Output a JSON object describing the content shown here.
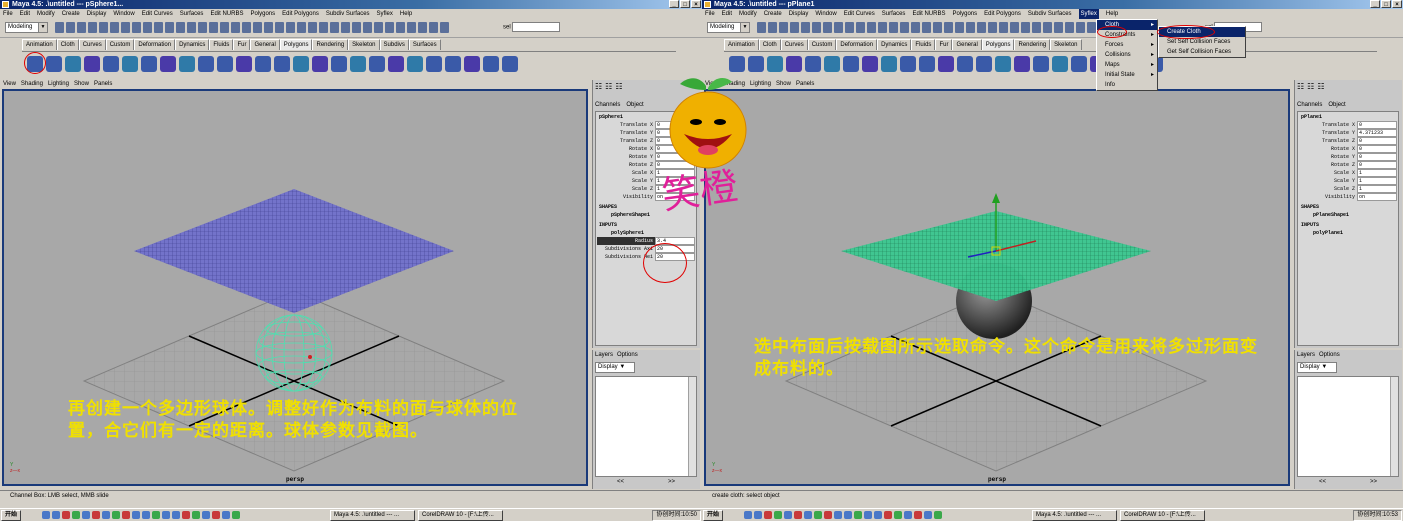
{
  "left": {
    "window_title": "Maya 4.5: .\\untitled  ---  pSphere1...",
    "menus": [
      "File",
      "Edit",
      "Modify",
      "Create",
      "Display",
      "Window",
      "Edit Curves",
      "Surfaces",
      "Edit NURBS",
      "Polygons",
      "Edit Polygons",
      "Subdiv Surfaces",
      "Syflex",
      "Help"
    ],
    "mode": "Modeling",
    "sel_label": "sel",
    "shelf_tabs": [
      "Animation",
      "Cloth",
      "Curves",
      "Custom",
      "Deformation",
      "Dynamics",
      "Fluids",
      "Fur",
      "General",
      "Polygons",
      "Rendering",
      "Skeleton",
      "Subdivs",
      "Surfaces"
    ],
    "active_tab": "Polygons",
    "viewport_menu": [
      "View",
      "Shading",
      "Lighting",
      "Show",
      "Panels"
    ],
    "camera": "persp",
    "channel_tabs": [
      "Channels",
      "Object"
    ],
    "object_name": "pSphere1",
    "channels": [
      {
        "label": "Translate X",
        "value": "0"
      },
      {
        "label": "Translate Y",
        "value": "0"
      },
      {
        "label": "Translate Z",
        "value": "0"
      },
      {
        "label": "Rotate X",
        "value": "0"
      },
      {
        "label": "Rotate Y",
        "value": "0"
      },
      {
        "label": "Rotate Z",
        "value": "0"
      },
      {
        "label": "Scale X",
        "value": "1"
      },
      {
        "label": "Scale Y",
        "value": "1"
      },
      {
        "label": "Scale Z",
        "value": "1"
      },
      {
        "label": "Visibility",
        "value": "on"
      }
    ],
    "shapes_label": "SHAPES",
    "shape_name": "pSphereShape1",
    "inputs_label": "INPUTS",
    "input_name": "polySphere1",
    "input_channels": [
      {
        "label": "Radius",
        "value": "3.4"
      },
      {
        "label": "Subdivisions Axi",
        "value": "20"
      },
      {
        "label": "Subdivisions Hei",
        "value": "20"
      }
    ],
    "layers_tabs": [
      "Layers",
      "Options"
    ],
    "layers_display": "Display",
    "help_line": "Channel Box: LMB select, MMB slide",
    "note": "再创建一个多边形球体。调整好作为布料的面与球体的位置，合它们有一定的距离。球体参数见截图。"
  },
  "right": {
    "window_title": "Maya 4.5: .\\untitled  ---  pPlane1",
    "menus": [
      "File",
      "Edit",
      "Modify",
      "Create",
      "Display",
      "Window",
      "Edit Curves",
      "Surfaces",
      "Edit NURBS",
      "Polygons",
      "Edit Polygons",
      "Subdiv Surfaces",
      "Syflex",
      "Help"
    ],
    "mode": "Modeling",
    "sel_label": "sel",
    "shelf_tabs": [
      "Animation",
      "Cloth",
      "Curves",
      "Custom",
      "Deformation",
      "Dynamics",
      "Fluids",
      "Fur",
      "General",
      "Polygons",
      "Rendering",
      "Skeleton"
    ],
    "active_tab": "Polygons",
    "viewport_menu": [
      "View",
      "Shading",
      "Lighting",
      "Show",
      "Panels"
    ],
    "camera": "persp",
    "channel_tabs": [
      "Channels",
      "Object"
    ],
    "object_name": "pPlane1",
    "channels": [
      {
        "label": "Translate X",
        "value": "0"
      },
      {
        "label": "Translate Y",
        "value": "4.371233"
      },
      {
        "label": "Translate Z",
        "value": "0"
      },
      {
        "label": "Rotate X",
        "value": "0"
      },
      {
        "label": "Rotate Y",
        "value": "0"
      },
      {
        "label": "Rotate Z",
        "value": "0"
      },
      {
        "label": "Scale X",
        "value": "1"
      },
      {
        "label": "Scale Y",
        "value": "1"
      },
      {
        "label": "Scale Z",
        "value": "1"
      },
      {
        "label": "Visibility",
        "value": "on"
      }
    ],
    "shapes_label": "SHAPES",
    "shape_name": "pPlaneShape1",
    "inputs_label": "INPUTS",
    "input_name": "polyPlane1",
    "layers_tabs": [
      "Layers",
      "Options"
    ],
    "layers_display": "Display",
    "help_line": "create cloth: select object",
    "syflex_menu": [
      "Cloth",
      "Constraints",
      "Forces",
      "Collisions",
      "Maps",
      "Initial State",
      "Info"
    ],
    "cloth_submenu": [
      "Create Cloth",
      "Set Self Collision Faces",
      "Get Self Collision Faces"
    ],
    "note": "选中布面后按载图所示选取命令。这个命令是用来将多过形面变成布料的。"
  },
  "taskbar": {
    "start_label": "开始",
    "task_maya": "Maya 4.5: .\\untitled  --- ...",
    "task_corel": "CorelDRAW 10 - [F:\\上传...",
    "clock_left": "协创时间:10:50",
    "clock_right": "协创时间:10:53"
  },
  "watermark": {
    "text": "笑橙"
  },
  "colors": {
    "mesh_blue": "#3a3a9a",
    "cloth_green": "#3ac890",
    "note_yellow": "#f0e000",
    "annotation_red": "#e00000",
    "viewport_border": "#1a3a7a"
  }
}
